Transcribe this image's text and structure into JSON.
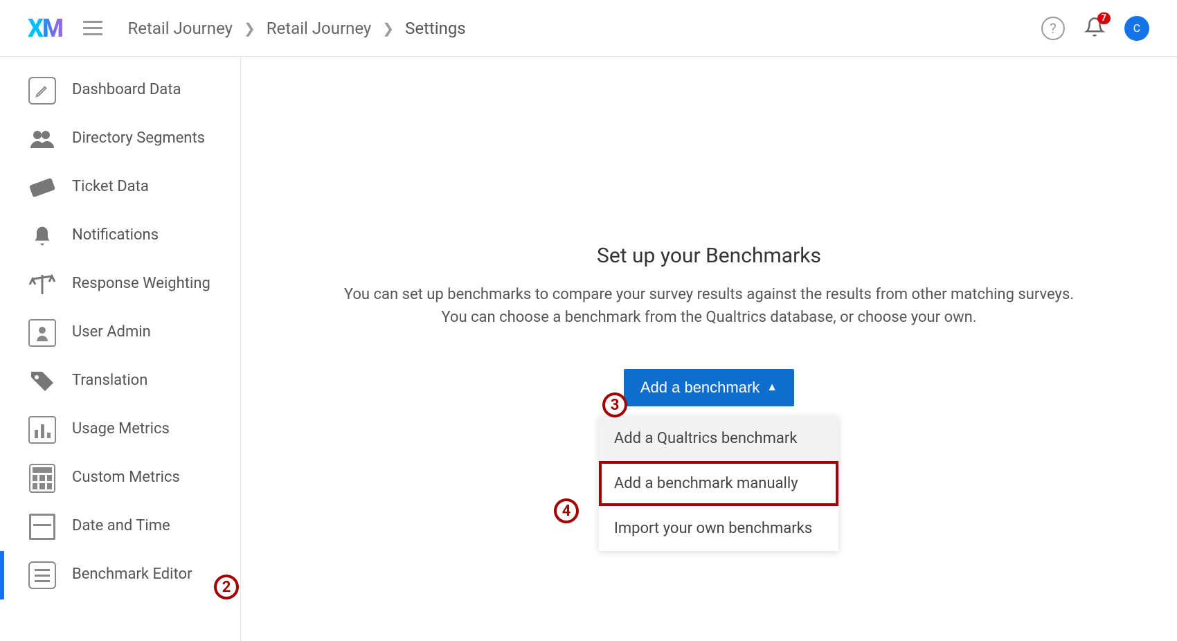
{
  "logo": "XM",
  "breadcrumb": [
    "Retail Journey",
    "Retail Journey",
    "Settings"
  ],
  "notification_count": "7",
  "avatar_initial": "C",
  "sidebar": {
    "items": [
      {
        "label": "Dashboard Data"
      },
      {
        "label": "Directory Segments"
      },
      {
        "label": "Ticket Data"
      },
      {
        "label": "Notifications"
      },
      {
        "label": "Response Weighting"
      },
      {
        "label": "User Admin"
      },
      {
        "label": "Translation"
      },
      {
        "label": "Usage Metrics"
      },
      {
        "label": "Custom Metrics"
      },
      {
        "label": "Date and Time"
      },
      {
        "label": "Benchmark Editor"
      }
    ]
  },
  "main": {
    "heading": "Set up your Benchmarks",
    "subtitle": "You can set up benchmarks to compare your survey results against the results from other matching surveys. You can choose a benchmark from the Qualtrics database, or choose your own.",
    "add_button_label": "Add a benchmark",
    "dropdown_options": [
      "Add a Qualtrics benchmark",
      "Add a benchmark manually",
      "Import your own benchmarks"
    ]
  },
  "annotations": {
    "a2": "2",
    "a3": "3",
    "a4": "4"
  }
}
